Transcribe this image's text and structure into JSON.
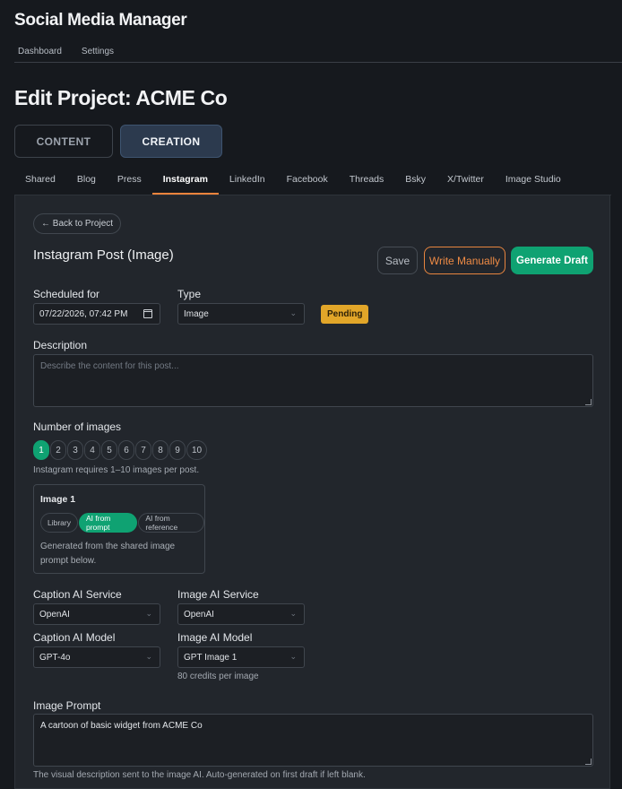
{
  "app": {
    "title": "Social Media Manager"
  },
  "topnav": [
    "Dashboard",
    "Settings"
  ],
  "page": {
    "title": "Edit Project: ACME Co"
  },
  "mode_tabs": {
    "content": "CONTENT",
    "creation": "CREATION"
  },
  "channel_tabs": [
    "Shared",
    "Blog",
    "Press",
    "Instagram",
    "LinkedIn",
    "Facebook",
    "Threads",
    "Bsky",
    "X/Twitter",
    "Image Studio"
  ],
  "active_channel": "Instagram",
  "panel": {
    "back_label": "← Back to Project",
    "post_title": "Instagram Post (Image)",
    "buttons": {
      "save": "Save",
      "write_manually": "Write Manually",
      "generate_draft": "Generate Draft"
    },
    "scheduled": {
      "label": "Scheduled for",
      "value": "07/22/2026, 07:42 PM"
    },
    "type": {
      "label": "Type",
      "value": "Image"
    },
    "status": "Pending",
    "description": {
      "label": "Description",
      "placeholder": "Describe the content for this post..."
    },
    "num_images": {
      "label": "Number of images",
      "options": [
        "1",
        "2",
        "3",
        "4",
        "5",
        "6",
        "7",
        "8",
        "9",
        "10"
      ],
      "selected": "1",
      "hint": "Instagram requires 1–10 images per post."
    },
    "image_card": {
      "title": "Image 1",
      "sources": [
        "Library",
        "AI from prompt",
        "AI from reference"
      ],
      "selected_source": "AI from prompt",
      "desc": "Generated from the shared image prompt below."
    },
    "caption_service": {
      "label": "Caption AI Service",
      "value": "OpenAI"
    },
    "image_service": {
      "label": "Image AI Service",
      "value": "OpenAI"
    },
    "caption_model": {
      "label": "Caption AI Model",
      "value": "GPT-4o"
    },
    "image_model": {
      "label": "Image AI Model",
      "value": "GPT Image 1",
      "credits": "80 credits per image"
    },
    "image_prompt": {
      "label": "Image Prompt",
      "value": "A cartoon of basic widget from ACME Co",
      "hint": "The visual description sent to the image AI. Auto-generated on first draft if left blank."
    }
  },
  "colors": {
    "accent_green": "#0fa272",
    "accent_orange": "#f0843c",
    "pending": "#e2a629",
    "background": "#16191e",
    "panel": "#22262c"
  }
}
